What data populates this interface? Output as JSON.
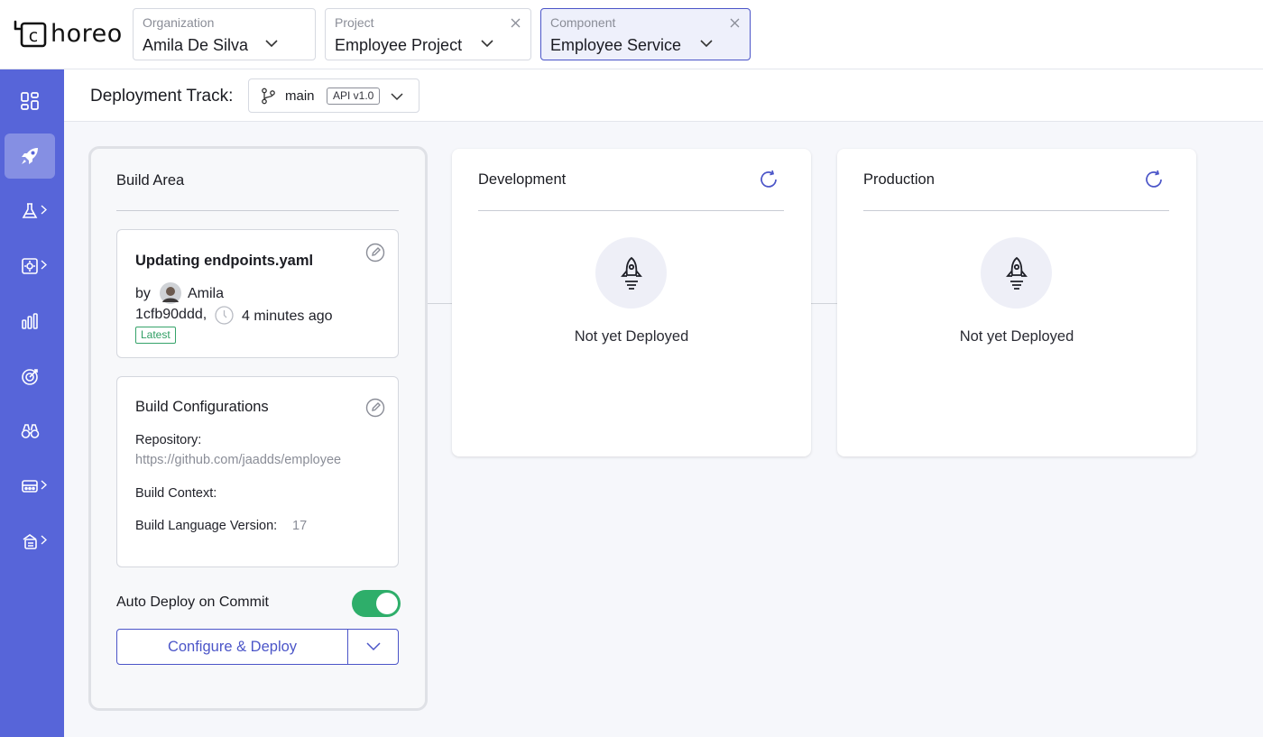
{
  "app": {
    "logo_text": "horeo",
    "logo_letter": "c"
  },
  "selectors": {
    "organization": {
      "label": "Organization",
      "value": "Amila De Silva"
    },
    "project": {
      "label": "Project",
      "value": "Employee Project"
    },
    "component": {
      "label": "Component",
      "value": "Employee Service"
    }
  },
  "sidebar": {
    "items": [
      {
        "icon": "overview-grid-icon"
      },
      {
        "icon": "deploy-rocket-icon",
        "active": true
      },
      {
        "icon": "test-flask-icon",
        "has_submenu": true
      },
      {
        "icon": "settings-gear-icon",
        "has_submenu": true
      },
      {
        "icon": "observability-chart-icon"
      },
      {
        "icon": "insights-target-icon"
      },
      {
        "icon": "devops-binoculars-icon"
      },
      {
        "icon": "dependencies-icon",
        "has_submenu": true
      },
      {
        "icon": "admin-icon",
        "has_submenu": true
      }
    ]
  },
  "deployment_track": {
    "title": "Deployment Track:",
    "branch": "main",
    "version_badge": "API v1.0"
  },
  "build_area": {
    "title": "Build Area",
    "latest_build": {
      "title": "Updating endpoints.yaml",
      "by_label": "by",
      "author": "Amila",
      "commit": "1cfb90ddd,",
      "time": "4 minutes ago",
      "badge": "Latest"
    },
    "build_config": {
      "title": "Build Configurations",
      "repository_label": "Repository:",
      "repository_value": "https://github.com/jaadds/employee",
      "context_label": "Build Context:",
      "language_version_label": "Build Language Version:",
      "language_version_value": "17"
    },
    "auto_deploy_label": "Auto Deploy on Commit",
    "auto_deploy_enabled": true,
    "deploy_button": "Configure & Deploy"
  },
  "environments": [
    {
      "name": "Development",
      "status": "Not yet Deployed"
    },
    {
      "name": "Production",
      "status": "Not yet Deployed"
    }
  ],
  "colors": {
    "accent": "#4b55c8",
    "sidebar": "#5765d9",
    "toggle_on": "#2eae6a",
    "latest_badge": "#2f9e63"
  }
}
